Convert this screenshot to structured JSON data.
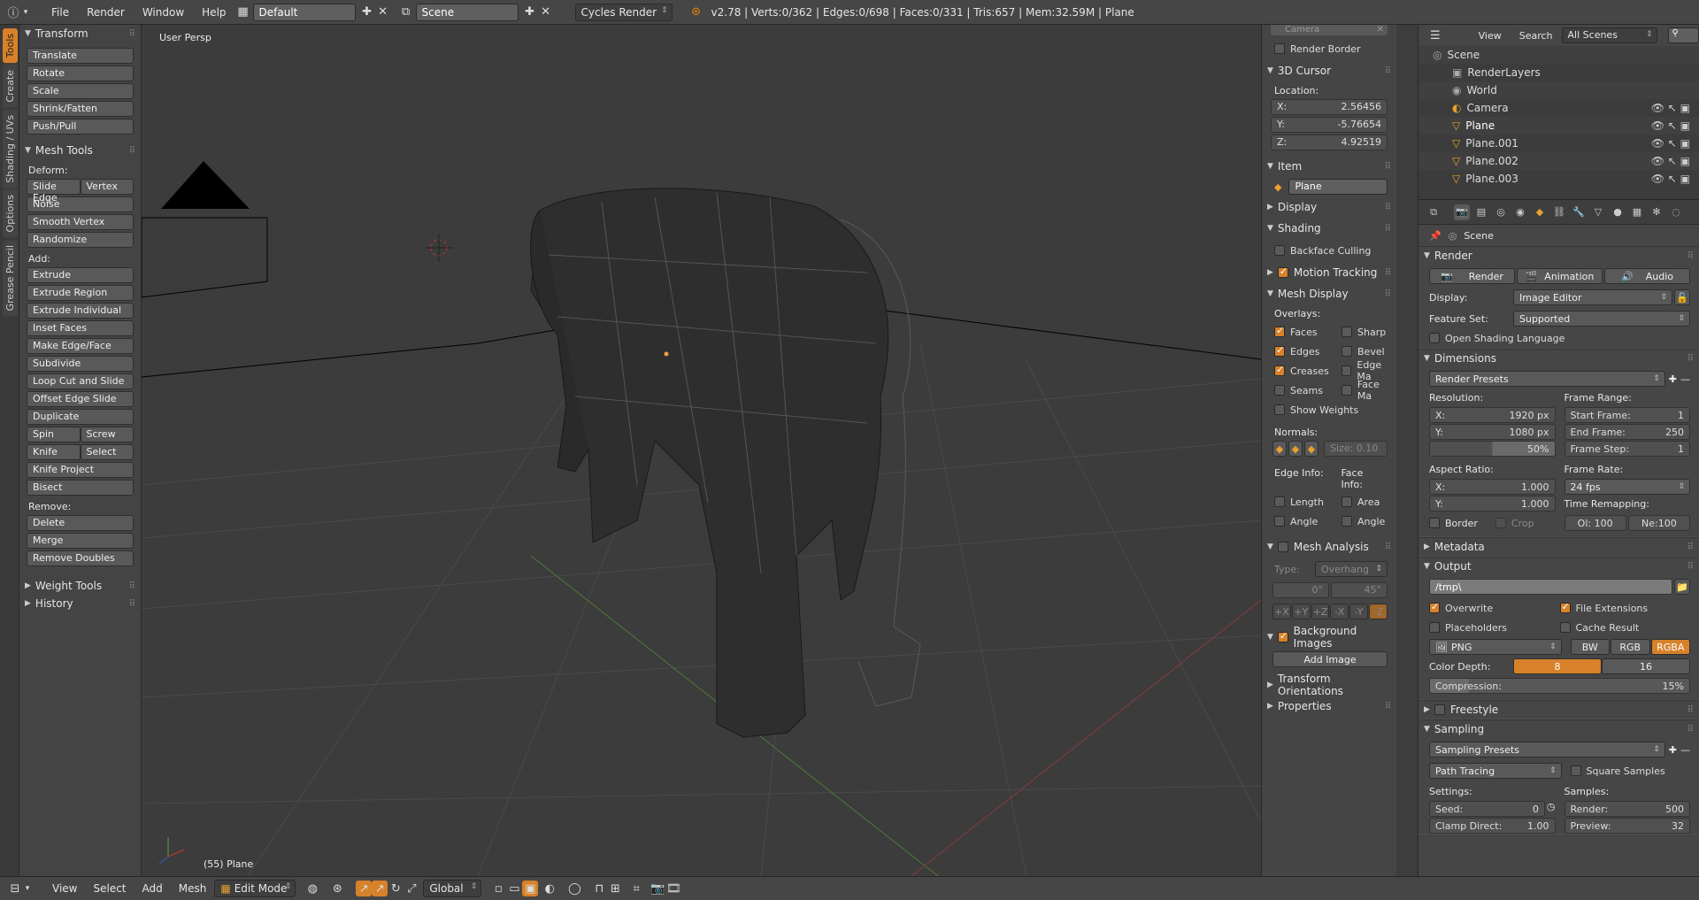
{
  "topbar": {
    "menus": [
      "File",
      "Render",
      "Window",
      "Help"
    ],
    "layout": "Default",
    "scene": "Scene",
    "engine": "Cycles Render",
    "stats": "v2.78 | Verts:0/362 | Edges:0/698 | Faces:0/331 | Tris:657 | Mem:32.59M | Plane"
  },
  "vtabs": [
    "Tools",
    "Create",
    "Shading / UVs",
    "Options",
    "Grease Pencil"
  ],
  "toolshelf": {
    "transform_title": "Transform",
    "transform": [
      "Translate",
      "Rotate",
      "Scale",
      "Shrink/Fatten",
      "Push/Pull"
    ],
    "meshtools_title": "Mesh Tools",
    "deform_label": "Deform:",
    "slide_edge": "Slide Edge",
    "vertex": "Vertex",
    "deform": [
      "Noise",
      "Smooth Vertex",
      "Randomize"
    ],
    "add_label": "Add:",
    "extrude": "Extrude",
    "add": [
      "Extrude Region",
      "Extrude Individual",
      "Inset Faces",
      "Make Edge/Face",
      "Subdivide",
      "Loop Cut and Slide",
      "Offset Edge Slide",
      "Duplicate"
    ],
    "spin": "Spin",
    "screw": "Screw",
    "knife": "Knife",
    "select": "Select",
    "add2": [
      "Knife Project",
      "Bisect"
    ],
    "remove_label": "Remove:",
    "delete": "Delete",
    "merge": "Merge",
    "remove_doubles": "Remove Doubles",
    "weight_tools": "Weight Tools",
    "history": "History"
  },
  "viewport": {
    "view_name": "User Persp",
    "object_label": "(55) Plane"
  },
  "npanel": {
    "camera_tab": "Camera",
    "render_border": "Render Border",
    "cursor_title": "3D Cursor",
    "location_label": "Location:",
    "x_label": "X:",
    "x_val": "2.56456",
    "y_label": "Y:",
    "y_val": "-5.76654",
    "z_label": "Z:",
    "z_val": "4.92519",
    "item_title": "Item",
    "item_name": "Plane",
    "display_title": "Display",
    "shading_title": "Shading",
    "backface": "Backface Culling",
    "motion_tracking": "Motion Tracking",
    "mesh_display": "Mesh Display",
    "overlays": "Overlays:",
    "faces": "Faces",
    "sharp": "Sharp",
    "edges": "Edges",
    "bevel": "Bevel",
    "creases": "Creases",
    "edge_ma": "Edge Ma",
    "seams": "Seams",
    "face_ma": "Face Ma",
    "show_weights": "Show Weights",
    "normals": "Normals:",
    "size": "Size: 0.10",
    "edge_info": "Edge Info:",
    "face_info": "Face Info:",
    "length": "Length",
    "area": "Area",
    "angle": "Angle",
    "angle2": "Angle",
    "mesh_analysis": "Mesh Analysis",
    "type_label": "Type:",
    "type_val": "Overhang",
    "deg0": "0°",
    "deg45": "45°",
    "axes": [
      "+X",
      "+Y",
      "+Z",
      "-X",
      "-Y",
      "-Z"
    ],
    "bg_images": "Background Images",
    "add_image": "Add Image",
    "transform_orient": "Transform Orientations",
    "properties": "Properties"
  },
  "outliner": {
    "view": "View",
    "search": "Search",
    "all_scenes": "All Scenes",
    "rows": [
      "Scene",
      "RenderLayers",
      "World",
      "Camera",
      "Plane",
      "Plane.001",
      "Plane.002",
      "Plane.003"
    ]
  },
  "props": {
    "scene": "Scene",
    "render_title": "Render",
    "render_btn": "Render",
    "animation_btn": "Animation",
    "audio_btn": "Audio",
    "display_label": "Display:",
    "display_val": "Image Editor",
    "feature_label": "Feature Set:",
    "feature_val": "Supported",
    "osl": "Open Shading Language",
    "dimensions_title": "Dimensions",
    "render_presets": "Render Presets",
    "resolution": "Resolution:",
    "res_x_label": "X:",
    "res_x": "1920 px",
    "res_y_label": "Y:",
    "res_y": "1080 px",
    "res_pct": "50%",
    "frame_range": "Frame Range:",
    "start_label": "Start Frame:",
    "start": "1",
    "end_label": "End Frame:",
    "end": "250",
    "step_label": "Frame Step:",
    "step": "1",
    "aspect": "Aspect Ratio:",
    "ax_label": "X:",
    "ax": "1.000",
    "ay_label": "Y:",
    "ay": "1.000",
    "frame_rate": "Frame Rate:",
    "fps": "24 fps",
    "time_remap": "Time Remapping:",
    "old": "Ol: 100",
    "new": "Ne:100",
    "border": "Border",
    "crop": "Crop",
    "metadata_title": "Metadata",
    "output_title": "Output",
    "output_path": "/tmp\\",
    "overwrite": "Overwrite",
    "file_ext": "File Extensions",
    "placeholders": "Placeholders",
    "cache_result": "Cache Result",
    "format": "PNG",
    "bw": "BW",
    "rgb": "RGB",
    "rgba": "RGBA",
    "color_depth": "Color Depth:",
    "depth8": "8",
    "depth16": "16",
    "compression": "Compression:",
    "compression_val": "15%",
    "freestyle_title": "Freestyle",
    "sampling_title": "Sampling",
    "sampling_presets": "Sampling Presets",
    "path_tracing": "Path Tracing",
    "square_samples": "Square Samples",
    "settings": "Settings:",
    "samples": "Samples:",
    "seed_label": "Seed:",
    "seed": "0",
    "render_s_label": "Render:",
    "render_s": "500",
    "clamp_label": "Clamp Direct:",
    "clamp": "1.00",
    "preview_label": "Preview:",
    "preview": "32"
  },
  "bottombar": {
    "menus": [
      "View",
      "Select",
      "Add",
      "Mesh"
    ],
    "mode": "Edit Mode",
    "orientation": "Global"
  },
  "colors": {
    "accent": "#d7822a",
    "bg": "#3c3c3c",
    "panel": "#464646"
  }
}
